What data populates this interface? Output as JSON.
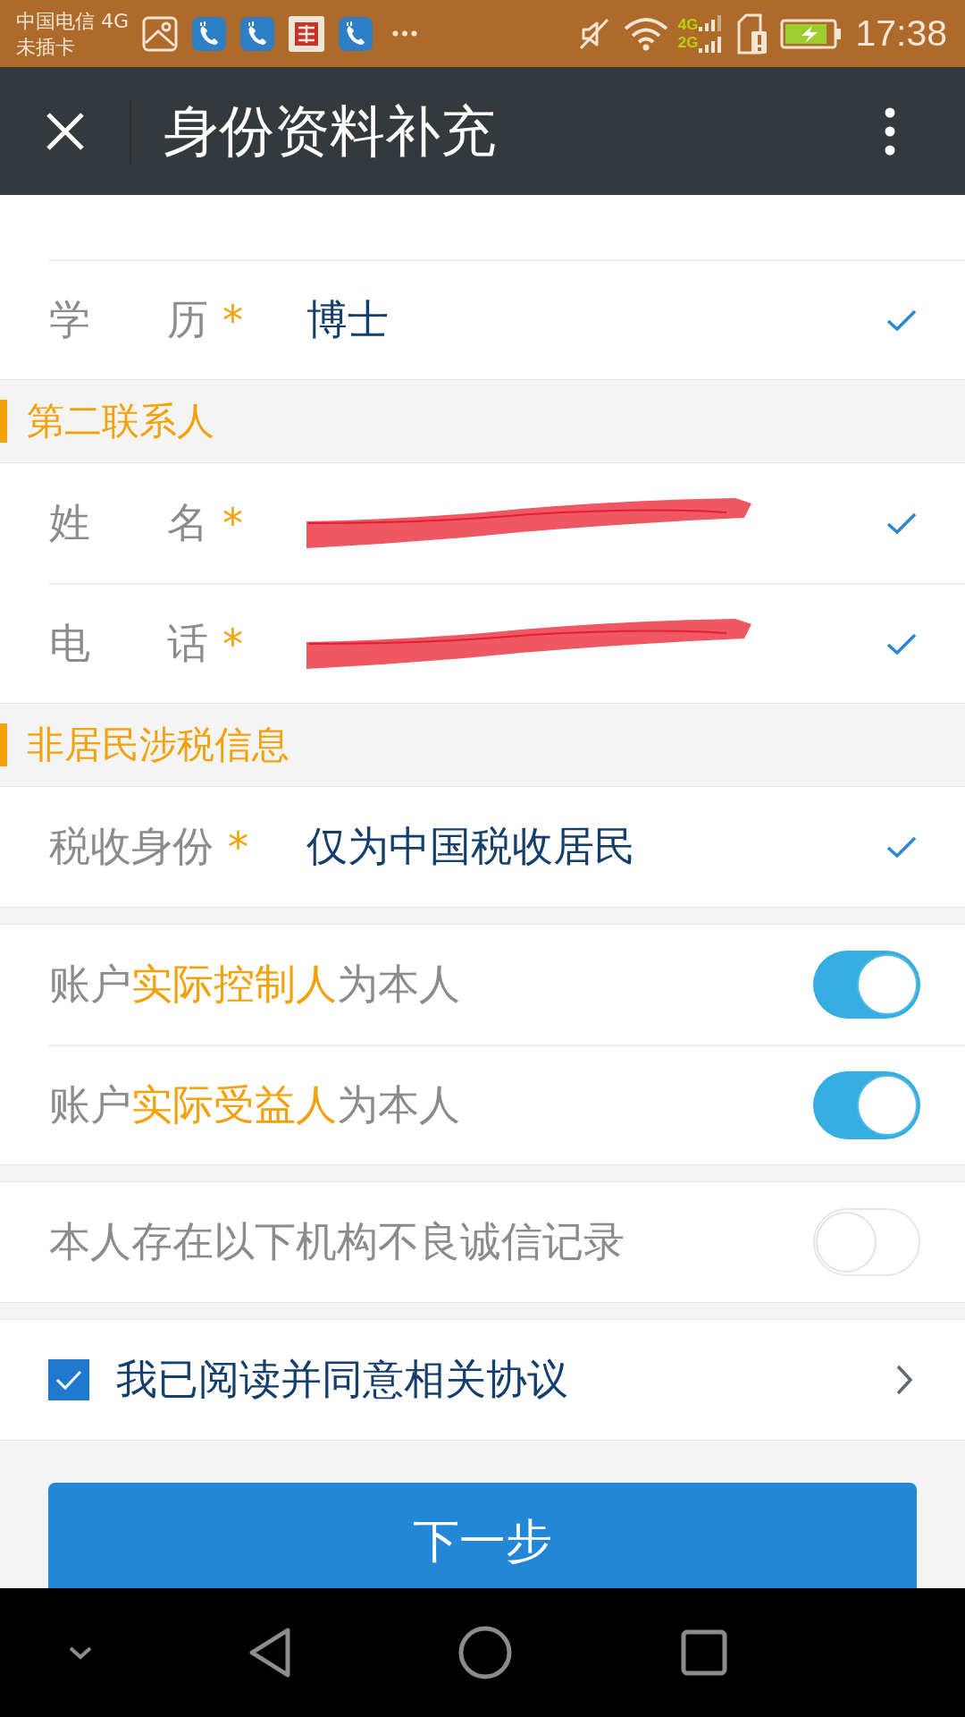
{
  "status_bar": {
    "carrier": "中国电信 4G",
    "sim_status": "未插卡",
    "network_labels": [
      "4G",
      "2G"
    ],
    "time": "17:38"
  },
  "header": {
    "title": "身份资料补充"
  },
  "sections": [
    {
      "kind": "fields",
      "rows": [
        {
          "label": "学 历",
          "required_mark": "*",
          "value": "博士",
          "redacted": false,
          "valid": true
        }
      ]
    },
    {
      "kind": "heading",
      "title": "第二联系人"
    },
    {
      "kind": "fields",
      "rows": [
        {
          "label": "姓 名",
          "required_mark": "*",
          "redacted": true,
          "valid": true
        },
        {
          "label": "电 话",
          "required_mark": "*",
          "redacted": true,
          "valid": true
        }
      ]
    },
    {
      "kind": "heading",
      "title": "非居民涉税信息"
    },
    {
      "kind": "fields",
      "rows": [
        {
          "label": "税收身份",
          "required_mark": "*",
          "value": "仅为中国税收居民",
          "redacted": false,
          "valid": true
        }
      ]
    },
    {
      "kind": "switches",
      "rows": [
        {
          "label_parts": [
            {
              "text": "账户",
              "highlight": false
            },
            {
              "text": "实际控制人",
              "highlight": true
            },
            {
              "text": "为本人",
              "highlight": false
            }
          ],
          "on": true
        },
        {
          "label_parts": [
            {
              "text": "账户",
              "highlight": false
            },
            {
              "text": "实际受益人",
              "highlight": true
            },
            {
              "text": "为本人",
              "highlight": false
            }
          ],
          "on": true
        }
      ]
    },
    {
      "kind": "switches",
      "rows": [
        {
          "label_parts": [
            {
              "text": "本人存在以下机构不良诚信记录",
              "highlight": false
            }
          ],
          "on": false
        }
      ]
    },
    {
      "kind": "agreement",
      "text": "我已阅读并同意相关协议",
      "checked": true
    }
  ],
  "next_button": {
    "label": "下一步"
  }
}
